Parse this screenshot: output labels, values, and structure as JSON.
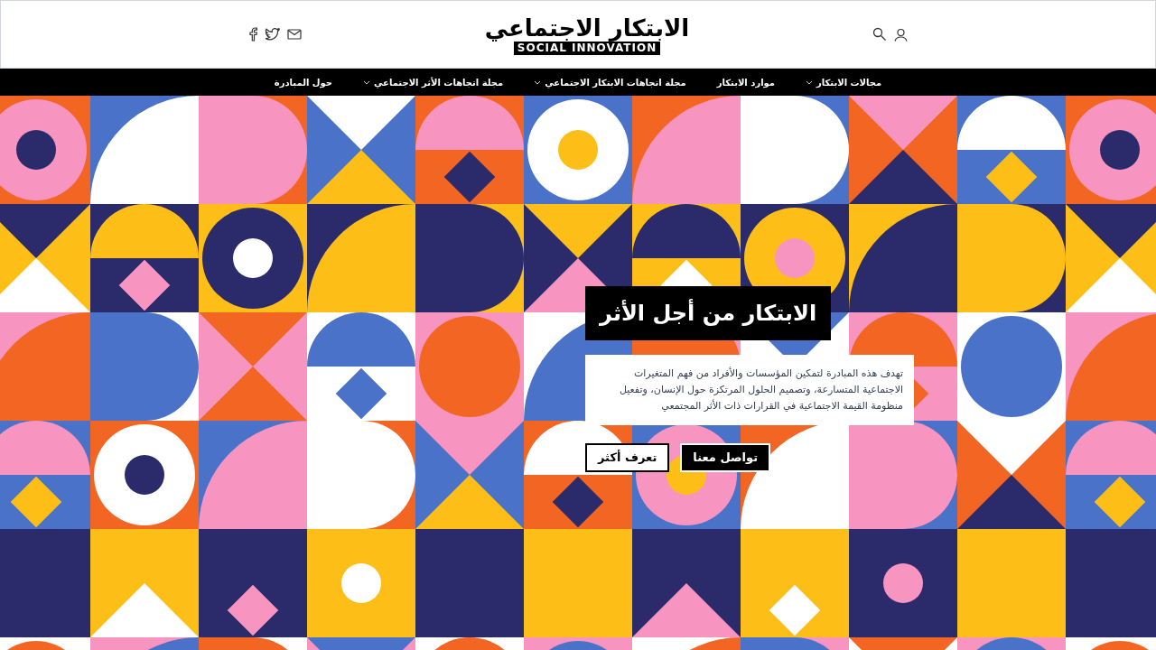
{
  "header": {
    "logo": {
      "arabic": "الابتكار الاجتماعي",
      "latin": "SOCIAL INNOVATION"
    }
  },
  "nav": [
    {
      "label": "مجالات الابتكار",
      "dropdown": true
    },
    {
      "label": "موارد الابتكار",
      "dropdown": false
    },
    {
      "label": "مجلة اتجاهات الابتكار الاجتماعي",
      "dropdown": true
    },
    {
      "label": "مجلة اتجاهات الأثر الاجتماعي",
      "dropdown": true
    },
    {
      "label": "حول المبادرة",
      "dropdown": false
    }
  ],
  "hero": {
    "title": "الابتكار من أجل الأثر",
    "description": "تهدف هذه المبادرة لتمكين المؤسسات والأفراد من فهم المتغيرات الاجتماعية المتسارعة، وتصميم الحلول المرتكزة حول الإنسان، وتفعيل منظومة القيمة الاجتماعية في القرارات ذات الأثر المجتمعي",
    "buttons": [
      {
        "label": "تواصل معنا",
        "kind": "primary"
      },
      {
        "label": "تعرف أكثر",
        "kind": "secondary"
      }
    ]
  }
}
